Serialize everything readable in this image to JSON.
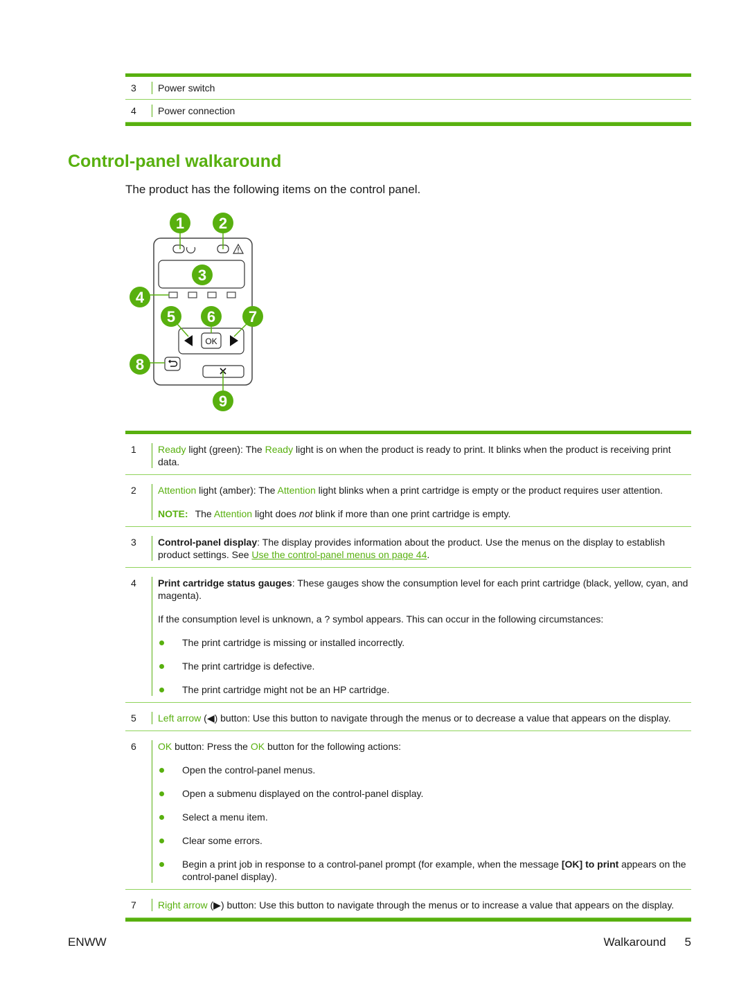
{
  "top_table": {
    "rows": [
      {
        "num": "3",
        "text": "Power switch"
      },
      {
        "num": "4",
        "text": "Power connection"
      }
    ]
  },
  "section": {
    "title": "Control-panel walkaround",
    "intro": "The product has the following items on the control panel."
  },
  "diagram": {
    "callouts": [
      "1",
      "2",
      "3",
      "4",
      "5",
      "6",
      "7",
      "8",
      "9"
    ],
    "ok_label": "OK",
    "icons": [
      "ready-light-icon",
      "attention-light-icon",
      "warning-triangle-icon",
      "display-screen",
      "gauge-icon",
      "left-arrow-icon",
      "ok-button",
      "right-arrow-icon",
      "back-icon",
      "cancel-icon"
    ],
    "accent_color": "#58b00f"
  },
  "main_table": {
    "rows": [
      {
        "num": "1",
        "term": "Ready",
        "part1": " light (green): The ",
        "term2": "Ready",
        "part2": " light is on when the product is ready to print. It blinks when the product is receiving print data."
      },
      {
        "num": "2",
        "term": "Attention",
        "part1": " light (amber): The ",
        "term2": "Attention",
        "part2": " light blinks when a print cartridge is empty or the product requires user attention.",
        "note_label": "NOTE:",
        "note_pre": "The ",
        "note_term": "Attention",
        "note_mid": " light does ",
        "note_em": "not",
        "note_post": " blink if more than one print cartridge is empty."
      },
      {
        "num": "3",
        "bold": "Control-panel display",
        "text": ": The display provides information about the product. Use the menus on the display to establish product settings. See ",
        "link": "Use the control-panel menus on page 44",
        "after": "."
      },
      {
        "num": "4",
        "bold": "Print cartridge status gauges",
        "text": ": These gauges show the consumption level for each print cartridge (black, yellow, cyan, and magenta).",
        "para2": "If the consumption level is unknown, a ? symbol appears. This can occur in the following circumstances:",
        "bullets": [
          "The print cartridge is missing or installed incorrectly.",
          "The print cartridge is defective.",
          "The print cartridge might not be an HP cartridge."
        ]
      },
      {
        "num": "5",
        "term": "Left arrow",
        "pre": " (",
        "symbol": "◀",
        "text": ") button: Use this button to navigate through the menus or to decrease a value that appears on the display."
      },
      {
        "num": "6",
        "term": "OK",
        "part1": " button: Press the ",
        "term2": "OK",
        "part2": " button for the following actions:",
        "bullets": [
          "Open the control-panel menus.",
          "Open a submenu displayed on the control-panel display.",
          "Select a menu item.",
          "Clear some errors."
        ],
        "last_bullet_pre": "Begin a print job in response to a control-panel prompt (for example, when the message ",
        "last_bullet_bold": "[OK] to print",
        "last_bullet_post": " appears on the control-panel display)."
      },
      {
        "num": "7",
        "term": "Right arrow",
        "pre": " (",
        "symbol": "▶",
        "text": ") button: Use this button to navigate through the menus or to increase a value that appears on the display."
      }
    ]
  },
  "footer": {
    "left": "ENWW",
    "section": "Walkaround",
    "page": "5"
  }
}
